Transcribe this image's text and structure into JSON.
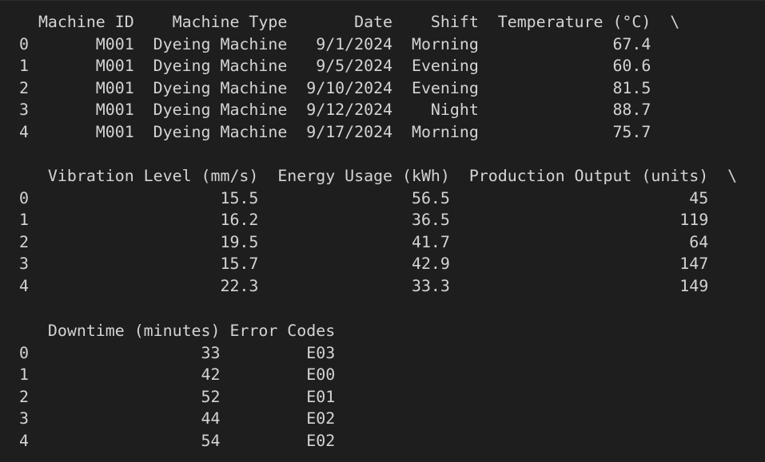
{
  "output": {
    "blocks": [
      {
        "header": "  Machine ID    Machine Type       Date    Shift  Temperature (°C)  \\",
        "rows": [
          "0       M001  Dyeing Machine   9/1/2024  Morning              67.4",
          "1       M001  Dyeing Machine   9/5/2024  Evening              60.6",
          "2       M001  Dyeing Machine  9/10/2024  Evening              81.5",
          "3       M001  Dyeing Machine  9/12/2024    Night              88.7",
          "4       M001  Dyeing Machine  9/17/2024  Morning              75.7"
        ]
      },
      {
        "header": "   Vibration Level (mm/s)  Energy Usage (kWh)  Production Output (units)  \\",
        "rows": [
          "0                    15.5                56.5                         45",
          "1                    16.2                36.5                        119",
          "2                    19.5                41.7                         64",
          "3                    15.7                42.9                        147",
          "4                    22.3                33.3                        149"
        ]
      },
      {
        "header": "   Downtime (minutes) Error Codes",
        "rows": [
          "0                  33         E03",
          "1                  42         E00",
          "2                  52         E01",
          "3                  44         E02",
          "4                  54         E02"
        ]
      }
    ]
  }
}
